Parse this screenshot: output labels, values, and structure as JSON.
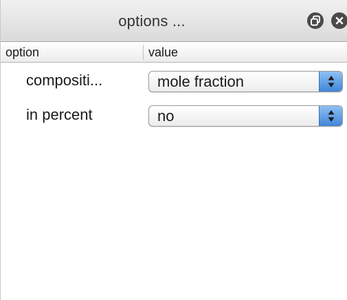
{
  "window": {
    "title": "options ..."
  },
  "columns": {
    "option": "option",
    "value": "value"
  },
  "rows": [
    {
      "option": "compositi...",
      "value": "mole fraction"
    },
    {
      "option": "in percent",
      "value": "no"
    }
  ],
  "colors": {
    "stepper_accent": "#4a8fe0",
    "title_button": "#4a4a4a"
  },
  "icons": {
    "float": "float-window-icon",
    "close": "close-icon",
    "stepper": "up-down-arrows-icon"
  }
}
